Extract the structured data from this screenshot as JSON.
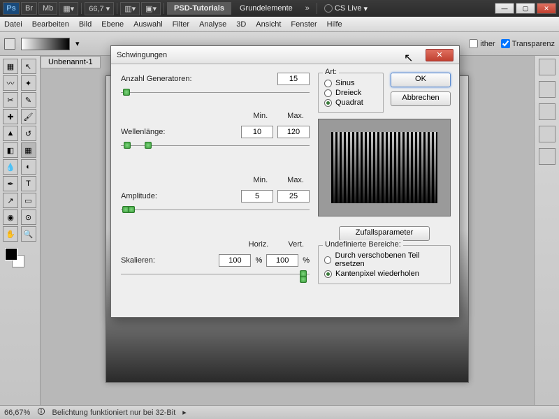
{
  "topbar": {
    "zoom": "66,7",
    "tab1": "PSD-Tutorials",
    "tab2": "Grundelemente",
    "cslive": "CS Live"
  },
  "menu": [
    "Datei",
    "Bearbeiten",
    "Bild",
    "Ebene",
    "Auswahl",
    "Filter",
    "Analyse",
    "3D",
    "Ansicht",
    "Fenster",
    "Hilfe"
  ],
  "options": {
    "dither": "ither",
    "transparency": "Transparenz"
  },
  "docTab": "Unbenannt-1",
  "status": {
    "zoom": "66,67%",
    "msg": "Belichtung funktioniert nur bei 32-Bit"
  },
  "dialog": {
    "title": "Schwingungen",
    "generators_label": "Anzahl Generatoren:",
    "generators_value": "15",
    "min": "Min.",
    "max": "Max.",
    "wavelength_label": "Wellenlänge:",
    "wavelength_min": "10",
    "wavelength_max": "120",
    "amplitude_label": "Amplitude:",
    "amplitude_min": "5",
    "amplitude_max": "25",
    "horiz": "Horiz.",
    "vert": "Vert.",
    "scale_label": "Skalieren:",
    "scale_h": "100",
    "scale_v": "100",
    "pct": "%",
    "art": "Art:",
    "type_sinus": "Sinus",
    "type_dreieck": "Dreieck",
    "type_quadrat": "Quadrat",
    "ok": "OK",
    "cancel": "Abbrechen",
    "random": "Zufallsparameter",
    "undef": "Undefinierte Bereiche:",
    "undef1": "Durch verschobenen Teil ersetzen",
    "undef2": "Kantenpixel wiederholen"
  }
}
